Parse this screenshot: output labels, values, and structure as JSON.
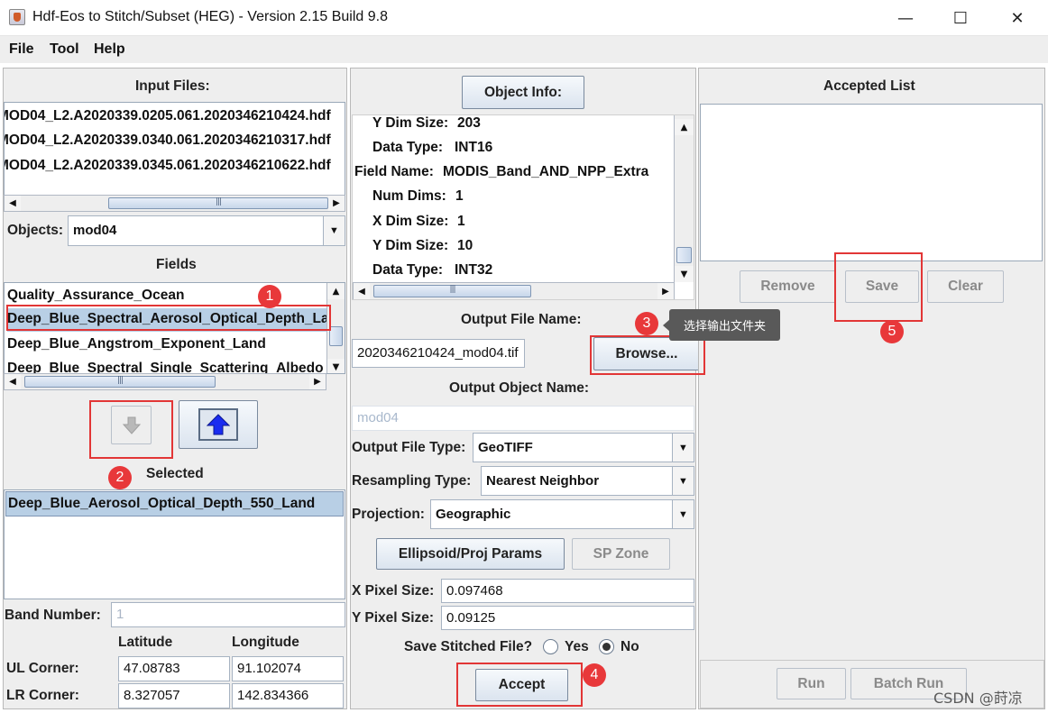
{
  "window": {
    "title": "Hdf-Eos to Stitch/Subset (HEG) - Version 2.15 Build 9.8",
    "minimize": "—",
    "maximize": "☐",
    "close": "✕"
  },
  "menu": [
    "File",
    "Tool",
    "Help"
  ],
  "left": {
    "input_files_label": "Input Files:",
    "input_files": [
      "MOD04_L2.A2020339.0205.061.2020346210424.hdf",
      "MOD04_L2.A2020339.0340.061.2020346210317.hdf",
      "MOD04_L2.A2020339.0345.061.2020346210622.hdf"
    ],
    "objects_label": "Objects:",
    "objects_value": "mod04",
    "fields_label": "Fields",
    "fields": [
      "Quality_Assurance_Ocean",
      "Deep_Blue_Spectral_Aerosol_Optical_Depth_Land",
      "Deep_Blue_Angstrom_Exponent_Land",
      "Deep_Blue_Spectral_Single_Scattering_Albedo_Land"
    ],
    "selected_label": "Selected",
    "selected": [
      "Deep_Blue_Aerosol_Optical_Depth_550_Land"
    ],
    "band_number_label": "Band Number:",
    "band_number_value": "1",
    "latitude_label": "Latitude",
    "longitude_label": "Longitude",
    "ul_label": "UL Corner:",
    "lr_label": "LR Corner:",
    "ul_lat": "47.08783",
    "ul_lon": "91.102074",
    "lr_lat": "8.327057",
    "lr_lon": "142.834366"
  },
  "middle": {
    "object_info_button": "Object Info:",
    "object_info_lines": [
      {
        "label": "Y Dim Size:",
        "value": "203"
      },
      {
        "label": "Data Type:",
        "value": "INT16"
      },
      {
        "label": "Field Name:",
        "value": "MODIS_Band_AND_NPP_Extra"
      },
      {
        "label": "Num Dims:",
        "value": "1"
      },
      {
        "label": "X Dim Size:",
        "value": "1"
      },
      {
        "label": "Y Dim Size:",
        "value": "10"
      },
      {
        "label": "Data Type:",
        "value": "INT32"
      }
    ],
    "output_file_name_label": "Output File Name:",
    "output_file_name_value": "2020346210424_mod04.tif",
    "browse_button": "Browse...",
    "tooltip": "选择输出文件夹",
    "output_object_name_label": "Output Object Name:",
    "output_object_name_value": "mod04",
    "output_file_type_label": "Output File Type:",
    "output_file_type_value": "GeoTIFF",
    "resampling_type_label": "Resampling Type:",
    "resampling_type_value": "Nearest Neighbor",
    "projection_label": "Projection:",
    "projection_value": "Geographic",
    "ellipsoid_button": "Ellipsoid/Proj Params",
    "sp_zone_button": "SP Zone",
    "x_pixel_label": "X Pixel Size:",
    "x_pixel_value": "0.097468",
    "y_pixel_label": "Y Pixel Size:",
    "y_pixel_value": "0.09125",
    "save_stitched_label": "Save Stitched File?",
    "yes_label": "Yes",
    "no_label": "No",
    "accept_button": "Accept"
  },
  "right": {
    "accepted_list_label": "Accepted List",
    "remove_button": "Remove",
    "save_button": "Save",
    "clear_button": "Clear",
    "run_button": "Run",
    "batch_run_button": "Batch Run"
  },
  "annotations": [
    "1",
    "2",
    "3",
    "4",
    "5"
  ],
  "watermark": "CSDN @莳凉",
  "colors": {
    "panel_bg": "#eeeeee",
    "highlight": "#b8cfe5",
    "annotation_red": "#e23636",
    "arrow_blue": "#1a2cf0"
  }
}
